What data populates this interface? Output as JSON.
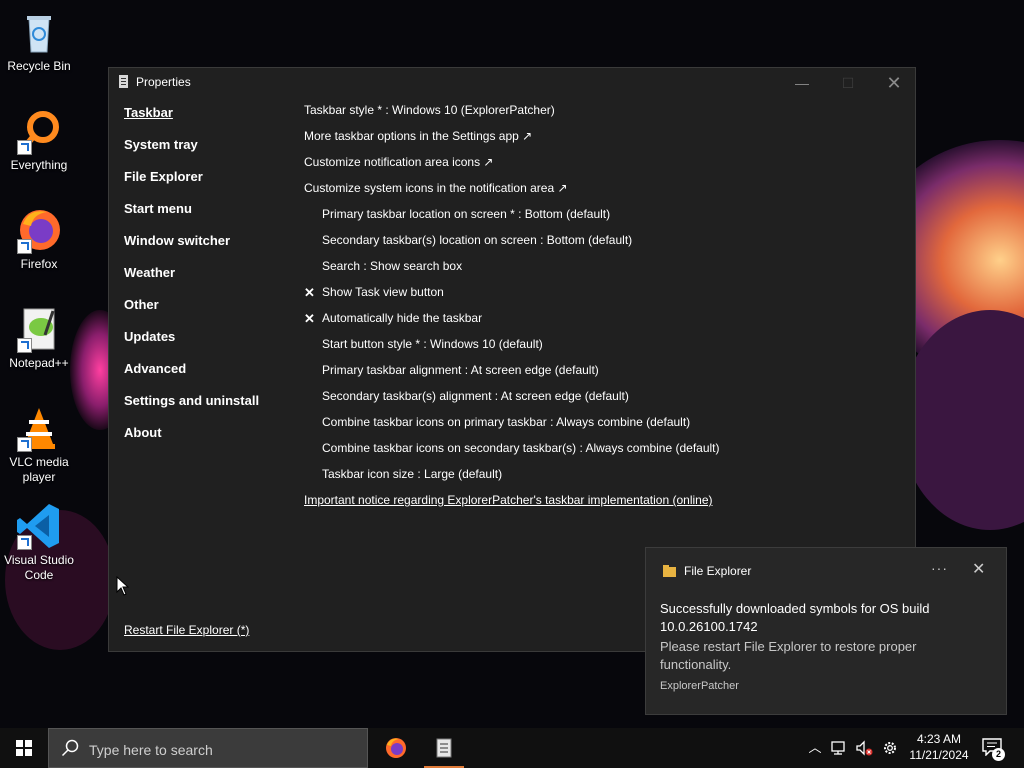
{
  "desktop": {
    "icons": [
      {
        "label": "Recycle Bin",
        "icon": "recycle-bin-icon"
      },
      {
        "label": "Everything",
        "icon": "everything-search-icon"
      },
      {
        "label": "Firefox",
        "icon": "firefox-icon"
      },
      {
        "label": "Notepad++",
        "icon": "notepadpp-icon"
      },
      {
        "label": "VLC media player",
        "icon": "vlc-icon"
      },
      {
        "label": "Visual Studio Code",
        "icon": "vscode-icon"
      }
    ]
  },
  "window": {
    "title": "Properties",
    "minimize": "—",
    "maximize": "☐",
    "close": "✕",
    "nav": [
      {
        "label": "Taskbar",
        "active": true
      },
      {
        "label": "System tray"
      },
      {
        "label": "File Explorer"
      },
      {
        "label": "Start menu"
      },
      {
        "label": "Window switcher"
      },
      {
        "label": "Weather"
      },
      {
        "label": "Other"
      },
      {
        "label": "Updates"
      },
      {
        "label": "Advanced"
      },
      {
        "label": "Settings and uninstall"
      },
      {
        "label": "About"
      }
    ],
    "restart_link": "Restart File Explorer (*)",
    "options": [
      {
        "label": "Taskbar style * : Windows 10 (ExplorerPatcher)"
      },
      {
        "label": "More taskbar options in the Settings app ↗"
      },
      {
        "label": "Customize notification area icons ↗"
      },
      {
        "label": "Customize system icons in the notification area ↗"
      },
      {
        "label": "Primary taskbar location on screen * : Bottom (default)"
      },
      {
        "label": "Secondary taskbar(s) location on screen : Bottom (default)"
      },
      {
        "label": "Search : Show search box"
      },
      {
        "label": "Show Task view button",
        "check": "✕"
      },
      {
        "label": "Automatically hide the taskbar",
        "check": "✕"
      },
      {
        "label": "Start button style * : Windows 10 (default)"
      },
      {
        "label": "Primary taskbar alignment : At screen edge (default)"
      },
      {
        "label": "Secondary taskbar(s) alignment : At screen edge (default)"
      },
      {
        "label": "Combine taskbar icons on primary taskbar : Always combine (default)"
      },
      {
        "label": "Combine taskbar icons on secondary taskbar(s) : Always combine (default)"
      },
      {
        "label": "Taskbar icon size : Large (default)"
      },
      {
        "label": "Important notice regarding ExplorerPatcher's taskbar implementation (online)"
      }
    ]
  },
  "toast": {
    "app_name": "File Explorer",
    "more": "···",
    "close": "✕",
    "title": "Successfully downloaded symbols for OS build 10.0.26100.1742",
    "body": "Please restart File Explorer to restore proper functionality.",
    "source": "ExplorerPatcher"
  },
  "taskbar": {
    "search_placeholder": "Type here to search",
    "clock_time": "4:23 AM",
    "clock_date": "11/21/2024",
    "notification_count": "2",
    "accent_color": "#e07b39"
  }
}
